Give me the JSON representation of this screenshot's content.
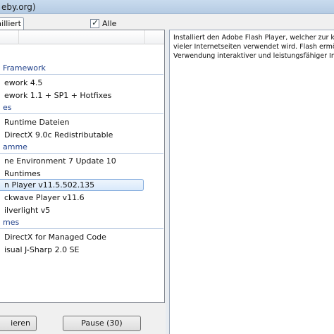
{
  "window": {
    "title": "eby.org)"
  },
  "toolbar": {
    "tab_label": "ailliert",
    "all_checkbox_label": "Alle",
    "all_checked": true
  },
  "list": {
    "groups": [
      {
        "label": "Framework"
      },
      {
        "label": "es"
      },
      {
        "label": "amme"
      },
      {
        "label": "mes"
      }
    ],
    "items": [
      {
        "label": "ework 4.5"
      },
      {
        "label": "ework 1.1 + SP1 + Hotfixes"
      },
      {
        "label": "Runtime Dateien"
      },
      {
        "label": "DirectX 9.0c Redistributable"
      },
      {
        "label": "ne Environment 7 Update 10"
      },
      {
        "label": "Runtimes"
      },
      {
        "label": "n Player v11.5.502.135",
        "selected": true
      },
      {
        "label": "ckwave Player v11.6"
      },
      {
        "label": "ilverlight v5"
      },
      {
        "label": "DirectX for Managed Code"
      },
      {
        "label": "isual J-Sharp 2.0 SE"
      }
    ]
  },
  "buttons": {
    "left_label": "ieren",
    "pause_label": "Pause (30)"
  },
  "description": {
    "line1": "Installiert den Adobe Flash Player, welcher zur korre",
    "line2": "vieler Internetseiten verwendet wird. Flash ermögli",
    "line3": "Verwendung interaktiver und leistungsfähiger Inter"
  }
}
